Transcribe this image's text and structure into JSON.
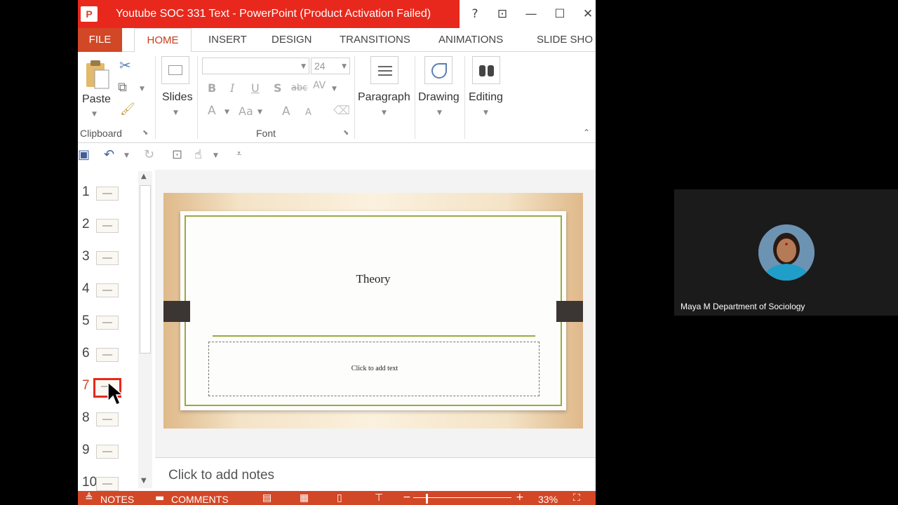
{
  "window": {
    "title": "Youtube SOC 331 Text -  PowerPoint (Product Activation Failed)",
    "app_icon": "powerpoint-icon",
    "controls": {
      "help": "?",
      "restore_ribbon": "⊡",
      "minimize": "—",
      "maximize": "☐",
      "close": "✕"
    }
  },
  "tabs": [
    "FILE",
    "HOME",
    "INSERT",
    "DESIGN",
    "TRANSITIONS",
    "ANIMATIONS",
    "SLIDE SHO"
  ],
  "active_tab": "HOME",
  "ribbon": {
    "clipboard": {
      "label": "Clipboard",
      "paste": "Paste"
    },
    "slides": {
      "label": "Slides"
    },
    "font": {
      "label": "Font",
      "font_name": "",
      "font_size": "24",
      "bold": "B",
      "italic": "I",
      "underline": "U",
      "shadow": "S",
      "strike": "abc",
      "spacing": "AV",
      "color": "A",
      "case": "Aa",
      "grow": "A",
      "shrink": "A"
    },
    "paragraph": {
      "label": "Paragraph"
    },
    "drawing": {
      "label": "Drawing"
    },
    "editing": {
      "label": "Editing"
    }
  },
  "thumbnails": [
    "1",
    "2",
    "3",
    "4",
    "5",
    "6",
    "7",
    "8",
    "9",
    "10"
  ],
  "selected_slide": "7",
  "slide": {
    "title": "Theory",
    "subtitle_placeholder": "Click to add text"
  },
  "notes": {
    "placeholder": "Click to add notes"
  },
  "status": {
    "notes": "NOTES",
    "comments": "COMMENTS",
    "zoom": "33%"
  },
  "colors": {
    "accent": "#d24726",
    "title_red": "#e8281c",
    "slide_border": "#9aa842"
  },
  "participant": {
    "name": "Maya M Department of Sociology"
  }
}
